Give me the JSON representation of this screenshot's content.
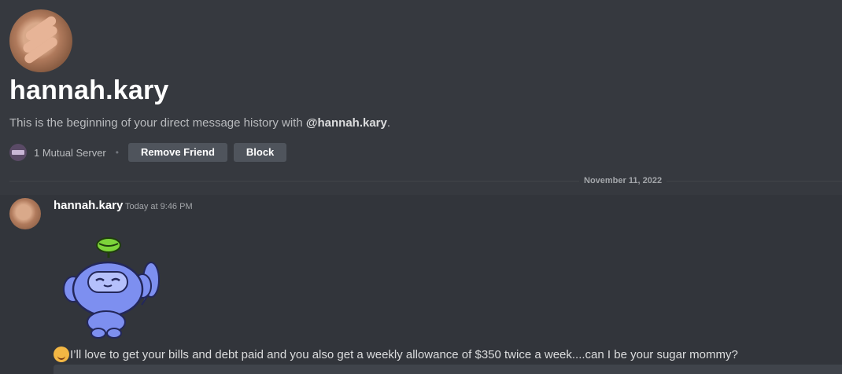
{
  "profile": {
    "username": "hannah.kary",
    "intro_prefix": "This is the beginning of your direct message history with ",
    "intro_mention": "@hannah.kary",
    "intro_suffix": ".",
    "mutual_servers": "1 Mutual Server",
    "separator": "•",
    "remove_friend_label": "Remove Friend",
    "block_label": "Block"
  },
  "divider": {
    "date": "November 11, 2022"
  },
  "message": {
    "author": "hannah.kary",
    "timestamp": "Today at 9:46 PM",
    "sticker": "wumpus-wave-sticker",
    "emoji": "smiling-face-with-hand-over-mouth-emoji",
    "text": "I’ll love to get your bills and debt paid and you also get a weekly allowance of $350 twice a week....can I be your sugar mommy?"
  },
  "colors": {
    "background": "#36393f",
    "message_background": "#32353b",
    "button": "#4f545c",
    "wumpus": "#7d8ff0"
  }
}
